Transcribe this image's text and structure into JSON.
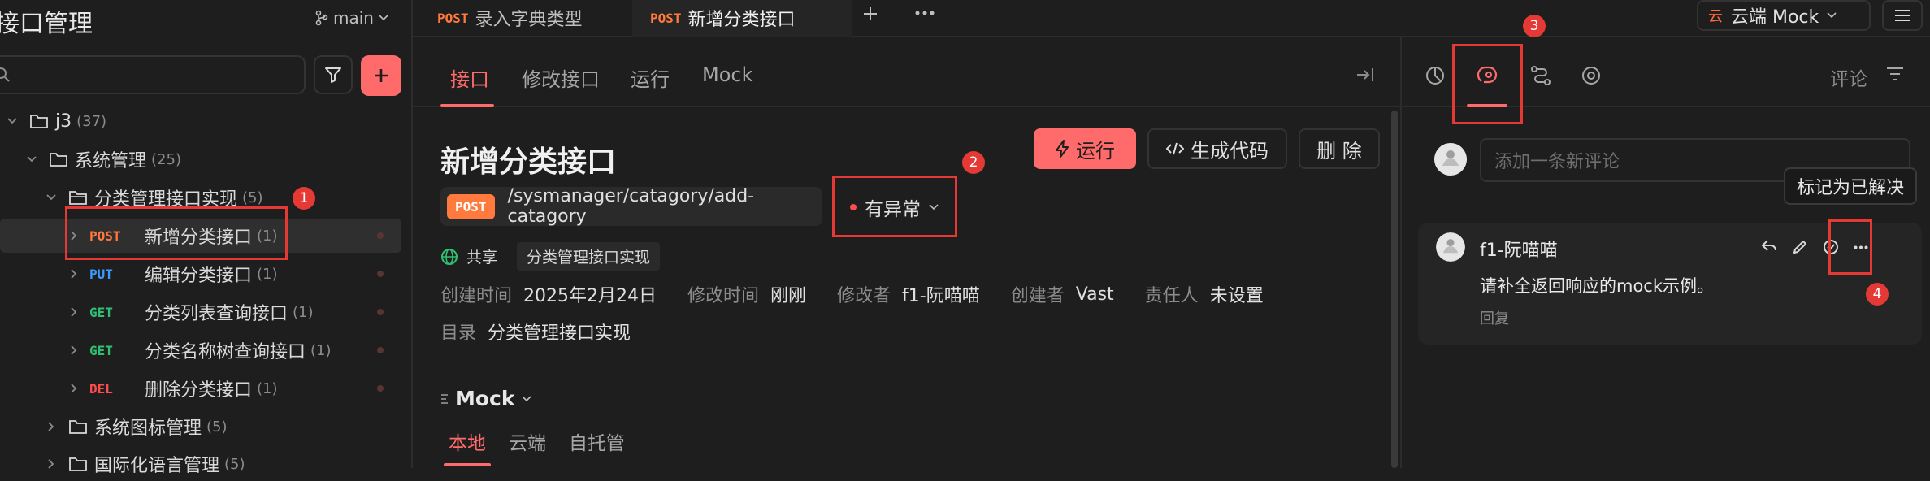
{
  "app": {
    "title": "接口管理",
    "branch": "main"
  },
  "tabs": [
    {
      "method": "POST",
      "label": "录入字典类型"
    },
    {
      "method": "POST",
      "label": "新增分类接口"
    }
  ],
  "tree": {
    "root": {
      "label": "j3",
      "count": "(37)"
    },
    "folder1": {
      "label": "系统管理",
      "count": "(25)"
    },
    "folder2": {
      "label": "分类管理接口实现",
      "count": "(5)"
    },
    "items": [
      {
        "method": "POST",
        "label": "新增分类接口",
        "count": "(1)"
      },
      {
        "method": "PUT",
        "label": "编辑分类接口",
        "count": "(1)"
      },
      {
        "method": "GET",
        "label": "分类列表查询接口",
        "count": "(1)"
      },
      {
        "method": "GET",
        "label": "分类名称树查询接口",
        "count": "(1)"
      },
      {
        "method": "DEL",
        "label": "删除分类接口",
        "count": "(1)"
      }
    ],
    "folder3": {
      "label": "系统图标管理",
      "count": "(5)"
    },
    "folder4": {
      "label": "国际化语言管理",
      "count": "(5)"
    }
  },
  "subtabs": [
    "接口",
    "修改接口",
    "运行",
    "Mock"
  ],
  "api": {
    "title": "新增分类接口",
    "method": "POST",
    "path": "/sysmanager/catagory/add-catagory",
    "status": "有异常",
    "share": "共享",
    "folder_tag": "分类管理接口实现",
    "created_label": "创建时间",
    "created": "2025年2月24日",
    "modified_label": "修改时间",
    "modified": "刚刚",
    "modifier_label": "修改者",
    "modifier": "f1-阮喵喵",
    "creator_label": "创建者",
    "creator": "Vast",
    "owner_label": "责任人",
    "owner": "未设置",
    "dir_label": "目录",
    "dir": "分类管理接口实现"
  },
  "buttons": {
    "run": "运行",
    "gen": "生成代码",
    "delete": "删 除"
  },
  "mock": {
    "title": "Mock",
    "tabs": [
      "本地",
      "云端",
      "自托管"
    ]
  },
  "env": {
    "label": "云端 Mock",
    "icon_char": "云"
  },
  "right": {
    "comment_tab": "评论",
    "input_placeholder": "添加一条新评论",
    "tooltip": "标记为已解决",
    "comment": {
      "author": "f1-阮喵喵",
      "text": "请补全返回响应的mock示例。",
      "reply": "回复"
    }
  },
  "annotations": [
    "1",
    "2",
    "3",
    "4"
  ],
  "colors": {
    "accent": "#ff6b6b",
    "post": "#ff7a3c",
    "put": "#3b9cff",
    "get": "#2fbf71",
    "del": "#ff4d4f",
    "annotation": "#e53935"
  }
}
